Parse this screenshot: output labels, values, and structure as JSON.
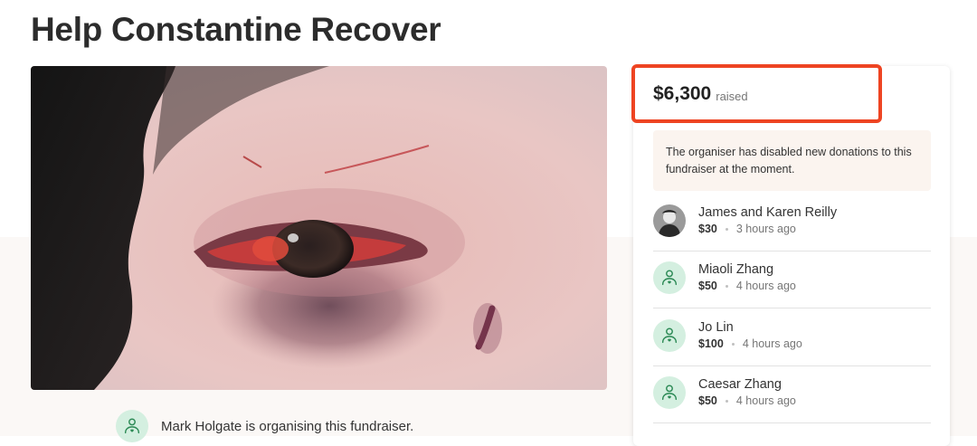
{
  "page": {
    "title": "Help Constantine Recover"
  },
  "hero": {
    "alt": "Close-up photo of an injured bruised eye"
  },
  "organiser": {
    "text": "Mark Holgate is organising this fundraiser."
  },
  "summary": {
    "amount": "$6,300",
    "label": "raised",
    "highlight_color": "#ee4422"
  },
  "notice": {
    "text": "The organiser has disabled new donations to this fundraiser at the moment."
  },
  "donations": [
    {
      "name": "James and Karen Reilly",
      "amount": "$30",
      "time": "3 hours ago",
      "avatar": "photo"
    },
    {
      "name": "Miaoli Zhang",
      "amount": "$50",
      "time": "4 hours ago",
      "avatar": "heart-hand-icon"
    },
    {
      "name": "Jo Lin",
      "amount": "$100",
      "time": "4 hours ago",
      "avatar": "heart-hand-icon"
    },
    {
      "name": "Caesar Zhang",
      "amount": "$50",
      "time": "4 hours ago",
      "avatar": "heart-hand-icon"
    }
  ],
  "colors": {
    "accent_green": "#2e8b57",
    "avatar_bg": "#d4efe0",
    "band_bg": "#fbf8f6"
  }
}
